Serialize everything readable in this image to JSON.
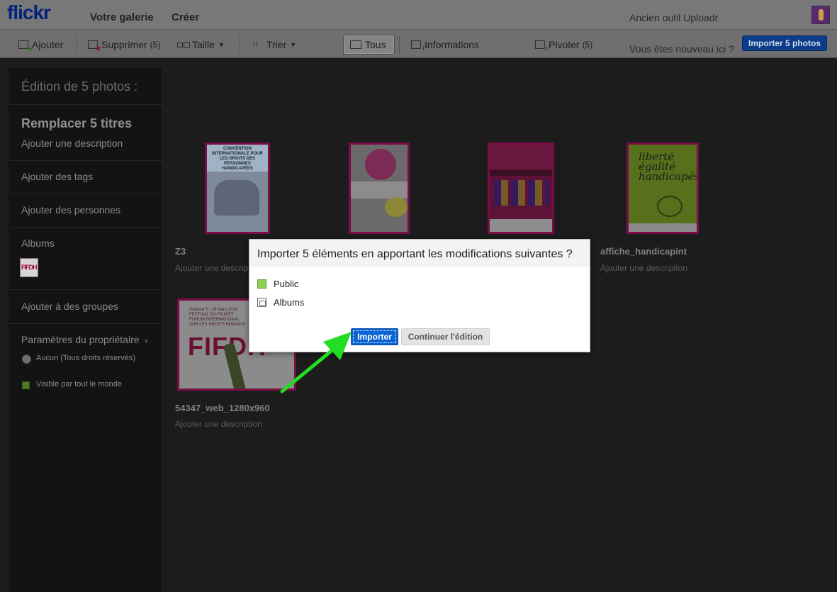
{
  "header": {
    "logo_main": "flickr",
    "logo_dot": "",
    "nav": [
      "Votre galerie",
      "Créer"
    ],
    "old_uploader": "Ancien outil Uploadr"
  },
  "toolbar": {
    "add": "Ajouter",
    "delete": "Supprimer",
    "delete_count": "(5)",
    "size": "Taille",
    "sort": "Trier",
    "all": "Tous",
    "info": "Informations",
    "rotate": "Pivoter",
    "rotate_count": "(5)",
    "new_question": "Vous êtes nouveau ici ?",
    "import_button": "Importer 5 photos"
  },
  "sidebar": {
    "title": "Édition de 5 photos :",
    "replace_titles": "Remplacer 5 titres",
    "add_description": "Ajouter une description",
    "add_tags": "Ajouter des tags",
    "add_people": "Ajouter des personnes",
    "albums": "Albums",
    "add_groups": "Ajouter à des groupes",
    "owner_settings": "Paramètres du propriétaire",
    "license": "Aucun (Tous droits réservés)",
    "visibility": "Visible par tout le monde"
  },
  "photos": [
    {
      "title": "Z3",
      "desc": "Ajouter une descrip"
    },
    {
      "title": "affiche_handicapint",
      "desc": "Ajouter une description"
    },
    {
      "title": "54347_web_1280x960",
      "desc": "Ajouter une description"
    }
  ],
  "poster_text": {
    "p1": "CONVENTION INTERNATIONALE POUR LES DROITS DES PERSONNES HANDICAPÉES",
    "p4": "liberté égalité handicapés",
    "p5_small": "Genève 5 - 18 mars 2016 FESTIVAL DU FILM ET FORUM INTERNATIONAL SUR LES DROITS HUMAINS",
    "p5_big": "FIFDH"
  },
  "dialog": {
    "title": "Importer 5 éléments en apportant les modifications suivantes ?",
    "options": [
      "Public",
      "Albums"
    ],
    "import": "Importer",
    "continue": "Continuer l'édition"
  },
  "colors": {
    "annotation_arrow": "#22dd22",
    "primary_button": "#0b64d4"
  }
}
